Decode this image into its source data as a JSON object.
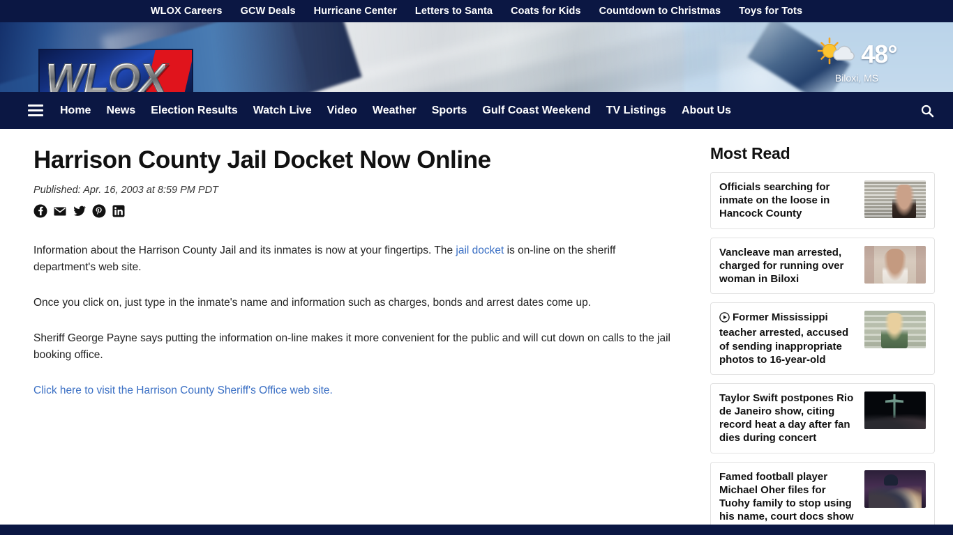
{
  "topbar": {
    "links": [
      {
        "label": "WLOX Careers"
      },
      {
        "label": "GCW Deals"
      },
      {
        "label": "Hurricane Center"
      },
      {
        "label": "Letters to Santa"
      },
      {
        "label": "Coats for Kids"
      },
      {
        "label": "Countdown to Christmas"
      },
      {
        "label": "Toys for Tots"
      }
    ]
  },
  "brand": {
    "logo_text": "WLOX",
    "accent_red": "#e0141c",
    "navy": "#0b1743"
  },
  "weather": {
    "icon": "sun-behind-cloud-icon",
    "temperature": "48°",
    "location": "Biloxi, MS"
  },
  "nav": {
    "menu_icon": "hamburger-icon",
    "search_icon": "search-icon",
    "items": [
      {
        "label": "Home"
      },
      {
        "label": "News"
      },
      {
        "label": "Election Results"
      },
      {
        "label": "Watch Live"
      },
      {
        "label": "Video"
      },
      {
        "label": "Weather"
      },
      {
        "label": "Sports"
      },
      {
        "label": "Gulf Coast Weekend"
      },
      {
        "label": "TV Listings"
      },
      {
        "label": "About Us"
      }
    ]
  },
  "article": {
    "headline": "Harrison County Jail Docket Now Online",
    "published": "Published: Apr. 16, 2003 at 8:59 PM PDT",
    "share": [
      {
        "name": "facebook-icon"
      },
      {
        "name": "email-icon"
      },
      {
        "name": "twitter-icon"
      },
      {
        "name": "pinterest-icon"
      },
      {
        "name": "linkedin-icon"
      }
    ],
    "p1_before": "Information about the Harrison County Jail and its inmates is now at your fingertips. The ",
    "p1_link": "jail docket",
    "p1_after": " is on-line on the sheriff department's web site.",
    "p2": "Once you click on, just type in the inmate's name and information such as charges, bonds and arrest dates come up.",
    "p3": "Sheriff George Payne says putting the information on-line makes it more convenient for the public and will cut down on calls to the jail booking office.",
    "link_text": "Click here to visit the Harrison County Sheriff's Office web site.",
    "link_color": "#3a6fc4"
  },
  "sidebar": {
    "title": "Most Read",
    "items": [
      {
        "title": "Officials searching for inmate on the loose in Hancock County",
        "has_video": false,
        "thumb": "mugshot-woman-thumbnail"
      },
      {
        "title": "Vancleave man arrested, charged for running over woman in Biloxi",
        "has_video": false,
        "thumb": "mugshot-man-thumbnail"
      },
      {
        "title": "Former Mississippi teacher arrested, accused of sending inappropriate photos to 16-year-old",
        "has_video": true,
        "video_icon": "play-circle-icon",
        "thumb": "mugshot-blonde-woman-thumbnail"
      },
      {
        "title": "Taylor Swift postpones Rio de Janeiro show, citing record heat a day after fan dies during concert",
        "has_video": false,
        "thumb": "christ-redeemer-statue-thumbnail"
      },
      {
        "title": "Famed football player Michael Oher files for Tuohy family to stop using his name, court docs show",
        "has_video": false,
        "thumb": "nfl-draft-stage-thumbnail"
      }
    ]
  }
}
